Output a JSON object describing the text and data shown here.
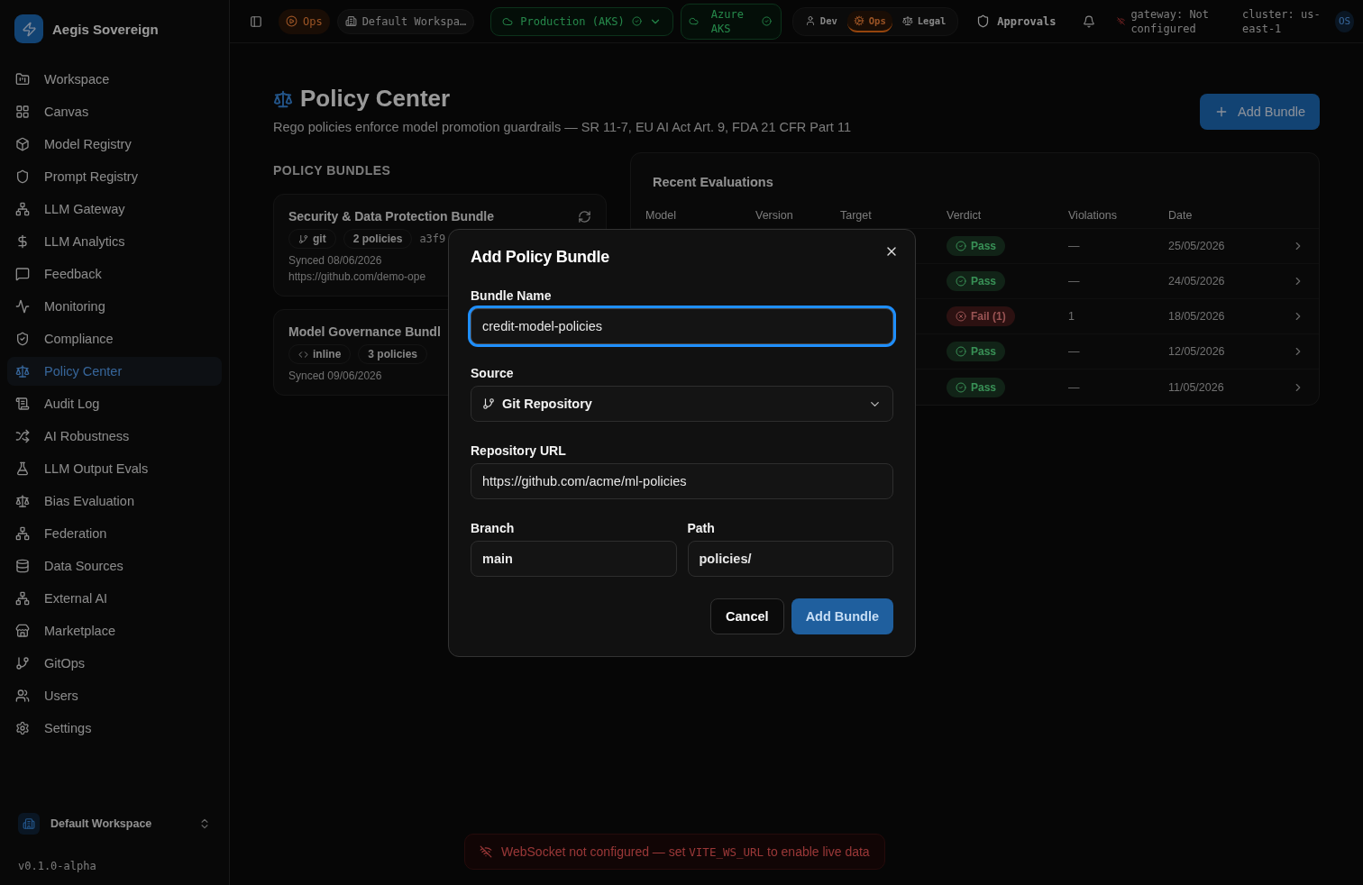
{
  "brand": {
    "name": "Aegis Sovereign"
  },
  "sidebar": {
    "items": [
      {
        "label": "Workspace",
        "selected": false
      },
      {
        "label": "Canvas",
        "selected": false
      },
      {
        "label": "Model Registry",
        "selected": false
      },
      {
        "label": "Prompt Registry",
        "selected": false
      },
      {
        "label": "LLM Gateway",
        "selected": false
      },
      {
        "label": "LLM Analytics",
        "selected": false
      },
      {
        "label": "Feedback",
        "selected": false
      },
      {
        "label": "Monitoring",
        "selected": false
      },
      {
        "label": "Compliance",
        "selected": false
      },
      {
        "label": "Policy Center",
        "selected": true
      },
      {
        "label": "Audit Log",
        "selected": false
      },
      {
        "label": "AI Robustness",
        "selected": false
      },
      {
        "label": "LLM Output Evals",
        "selected": false
      },
      {
        "label": "Bias Evaluation",
        "selected": false
      },
      {
        "label": "Federation",
        "selected": false
      },
      {
        "label": "Data Sources",
        "selected": false
      },
      {
        "label": "External AI",
        "selected": false
      },
      {
        "label": "Marketplace",
        "selected": false
      },
      {
        "label": "GitOps",
        "selected": false
      },
      {
        "label": "Users",
        "selected": false
      },
      {
        "label": "Settings",
        "selected": false
      }
    ],
    "workspace": "Default Workspace",
    "version": "v0.1.0-alpha"
  },
  "topbar": {
    "mode": "Ops",
    "workspace": "Default Workspa…",
    "environment": "Production (AKS)",
    "cluster_badge": "Azure AKS",
    "roles": [
      {
        "label": "Dev",
        "selected": false
      },
      {
        "label": "Ops",
        "selected": true
      },
      {
        "label": "Legal",
        "selected": false
      }
    ],
    "approvals": "Approvals",
    "gateway": "gateway: Not configured",
    "cluster": "cluster: us-east-1",
    "avatar": "OS"
  },
  "page": {
    "title": "Policy Center",
    "subtitle": "Rego policies enforce model promotion guardrails — SR 11-7, EU AI Act Art. 9, FDA 21 CFR Part 11",
    "add_button": "Add Bundle"
  },
  "bundles": {
    "heading": "POLICY BUNDLES",
    "items": [
      {
        "name": "Security & Data Protection Bundle",
        "kind": "git",
        "source": "git",
        "count": "2 policies",
        "hash": "a3f9",
        "synced": "Synced 08/06/2026",
        "url": "https://github.com/demo-ope"
      },
      {
        "name": "Model Governance Bundl",
        "kind": "inline",
        "source": "inline",
        "count": "3 policies",
        "synced": "Synced 09/06/2026"
      }
    ]
  },
  "evaluations": {
    "title": "Recent Evaluations",
    "columns": [
      "Model",
      "Version",
      "Target",
      "Verdict",
      "Violations",
      "Date"
    ],
    "rows": [
      {
        "verdict": "Pass",
        "kind": "pass",
        "violations": "—",
        "date": "25/05/2026"
      },
      {
        "verdict": "Pass",
        "kind": "pass",
        "violations": "—",
        "date": "24/05/2026"
      },
      {
        "verdict": "Fail (1)",
        "kind": "fail",
        "violations": "1",
        "date": "18/05/2026"
      },
      {
        "verdict": "Pass",
        "kind": "pass",
        "violations": "—",
        "date": "12/05/2026"
      },
      {
        "verdict": "Pass",
        "kind": "pass",
        "violations": "—",
        "date": "11/05/2026"
      }
    ]
  },
  "dialog": {
    "title": "Add Policy Bundle",
    "name_label": "Bundle Name",
    "name_value": "credit-model-policies",
    "name_focused": true,
    "source_label": "Source",
    "source_value": "Git Repository",
    "url_label": "Repository URL",
    "url_value": "https://github.com/acme/ml-policies",
    "branch_label": "Branch",
    "branch_value": "main",
    "path_label": "Path",
    "path_value": "policies/",
    "cancel": "Cancel",
    "submit": "Add Bundle"
  },
  "toast": {
    "before": "WebSocket not configured — set ",
    "code": "VITE_WS_URL",
    "after": " to enable live data"
  }
}
